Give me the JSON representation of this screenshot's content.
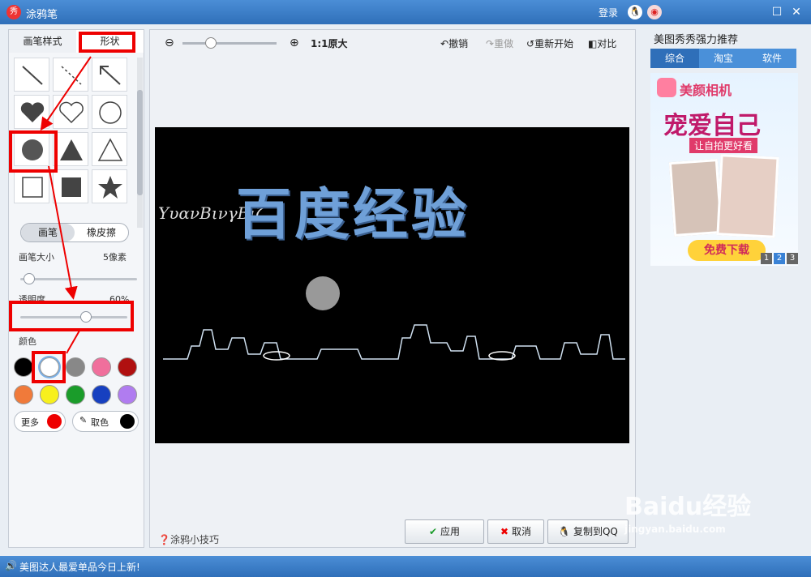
{
  "titlebar": {
    "title": "涂鸦笔",
    "app_icon_char": "秀",
    "login": "登录"
  },
  "left": {
    "tabs": [
      "画笔样式",
      "形状"
    ],
    "modes": [
      "画笔",
      "橡皮擦"
    ],
    "brush_size_label": "画笔大小",
    "brush_size_value": "5像素",
    "opacity_label": "透明度",
    "opacity_value": "60%",
    "color_label": "颜色",
    "more_label": "更多",
    "pick_label": "取色",
    "colors": [
      "#000000",
      "#ffffff",
      "#888888",
      "#f06f9c",
      "#b01010",
      "#f07a3a",
      "#f7f01d",
      "#1a9c2a",
      "#1740c0",
      "#b07cf0"
    ]
  },
  "toolbar": {
    "zoom_label": "1:1原大",
    "undo": "撤销",
    "redo": "重做",
    "restart": "重新开始",
    "compare": "对比"
  },
  "image": {
    "script_text": "ΥυανΒινγΒιζ",
    "big_text": "百度经验"
  },
  "bottom": {
    "tips": "涂鸦小技巧",
    "apply": "应用",
    "cancel": "取消",
    "copy": "复制到QQ"
  },
  "right": {
    "title": "美图秀秀强力推荐",
    "tabs": [
      "综合",
      "淘宝",
      "软件"
    ],
    "ad_brand": "美颜相机",
    "ad_headline": "宠爱自己",
    "ad_sub": "让自拍更好看",
    "ad_download": "免费下载",
    "ad_pages": [
      "1",
      "2",
      "3"
    ]
  },
  "status": {
    "message": "美图达人最爱单品今日上新!"
  },
  "watermark": {
    "main": "Baidu经验",
    "sub": "jingyan.baidu.com"
  }
}
